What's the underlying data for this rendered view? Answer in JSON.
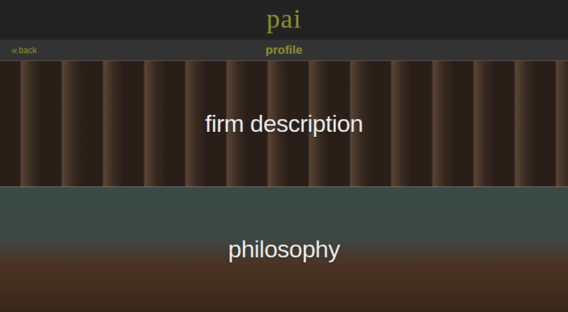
{
  "header": {
    "logo": "pai"
  },
  "nav": {
    "back": {
      "icon": "«",
      "label": "back"
    },
    "title": "profile"
  },
  "sections": [
    {
      "label": "firm description",
      "tone": "wood"
    },
    {
      "label": "philosophy",
      "tone": "table"
    }
  ]
}
